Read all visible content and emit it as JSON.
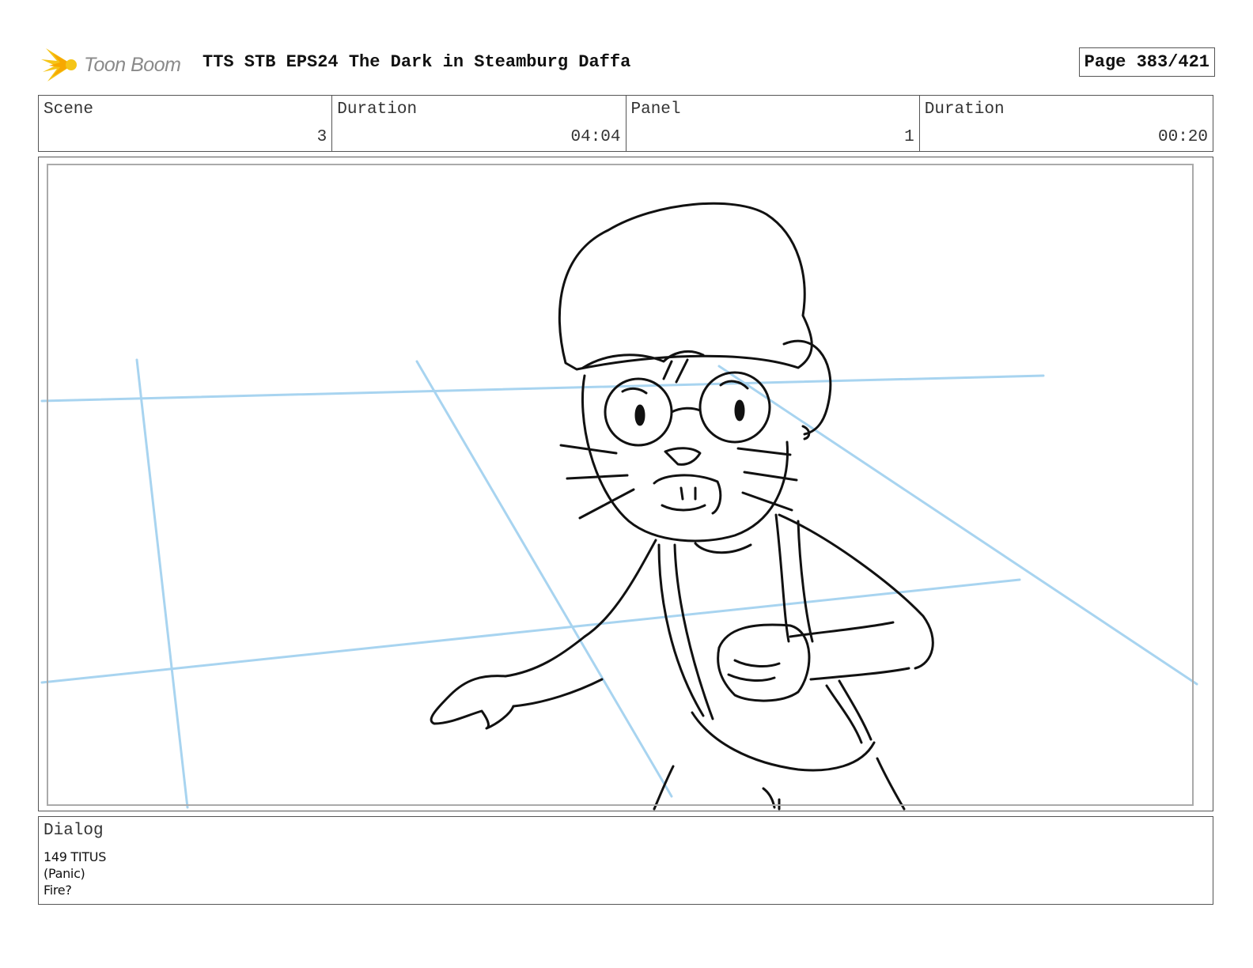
{
  "header": {
    "logo_text": "Toon Boom",
    "title": "TTS STB EPS24 The Dark in Steamburg Daffa",
    "page_label": "Page 383/421"
  },
  "info": {
    "scene_label": "Scene",
    "scene_value": "3",
    "scene_duration_label": "Duration",
    "scene_duration_value": "04:04",
    "panel_label": "Panel",
    "panel_value": "1",
    "panel_duration_label": "Duration",
    "panel_duration_value": "00:20"
  },
  "dialog": {
    "label": "Dialog",
    "lines": [
      "149 TITUS",
      "(Panic)",
      "Fire?"
    ]
  },
  "colors": {
    "logo_burst": "#f5c518",
    "guide_lines": "#a8d4f0",
    "sketch_lines": "#111111"
  },
  "icons": {
    "logo": "toon-boom-burst-icon"
  }
}
